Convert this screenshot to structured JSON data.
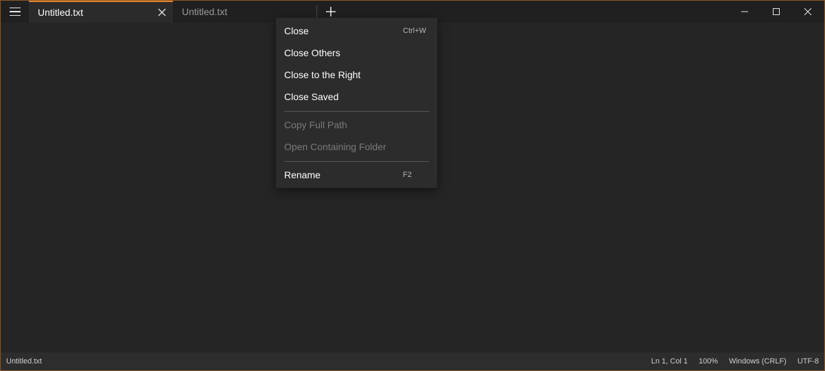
{
  "tabs": [
    {
      "label": "Untitled.txt",
      "active": true
    },
    {
      "label": "Untitled.txt",
      "active": false
    }
  ],
  "context_menu": {
    "items": [
      {
        "label": "Close",
        "shortcut": "Ctrl+W",
        "enabled": true
      },
      {
        "label": "Close Others",
        "shortcut": "",
        "enabled": true
      },
      {
        "label": "Close to the Right",
        "shortcut": "",
        "enabled": true
      },
      {
        "label": "Close Saved",
        "shortcut": "",
        "enabled": true
      },
      {
        "label": "Copy Full Path",
        "shortcut": "",
        "enabled": false
      },
      {
        "label": "Open Containing Folder",
        "shortcut": "",
        "enabled": false
      },
      {
        "label": "Rename",
        "shortcut": "F2",
        "enabled": true
      }
    ]
  },
  "statusbar": {
    "file_name": "Untitled.txt",
    "position": "Ln 1, Col 1",
    "zoom": "100%",
    "line_ending": "Windows (CRLF)",
    "encoding": "UTF-8"
  },
  "colors": {
    "accent": "#e2832b",
    "background": "#252525",
    "titlebar": "#202020",
    "statusbar": "#2d2d2d",
    "menu": "#2c2c2c"
  },
  "icons": {
    "menu": "hamburger-icon",
    "tab_close": "close-icon",
    "new_tab": "plus-icon",
    "minimize": "minimize-icon",
    "maximize": "maximize-icon",
    "window_close": "close-icon"
  }
}
